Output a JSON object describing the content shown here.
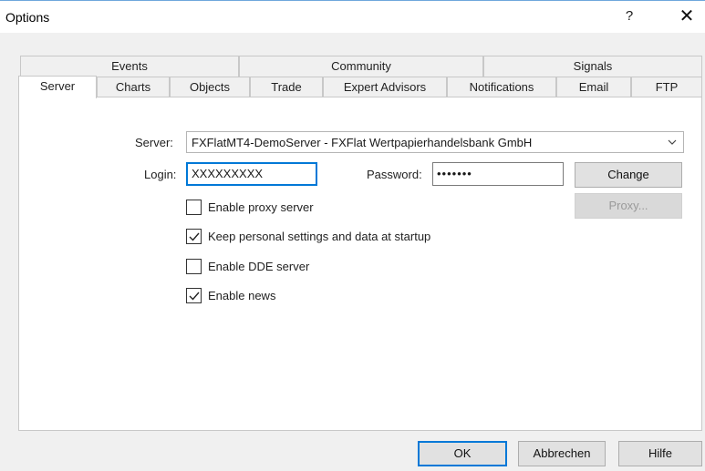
{
  "window": {
    "title": "Options",
    "help_glyph": "?",
    "close_glyph": "✕"
  },
  "tabs_top": [
    {
      "label": "Events"
    },
    {
      "label": "Community"
    },
    {
      "label": "Signals"
    }
  ],
  "tabs_bottom": [
    {
      "label": "Server",
      "active": true
    },
    {
      "label": "Charts"
    },
    {
      "label": "Objects"
    },
    {
      "label": "Trade"
    },
    {
      "label": "Expert Advisors"
    },
    {
      "label": "Notifications"
    },
    {
      "label": "Email"
    },
    {
      "label": "FTP"
    }
  ],
  "server": {
    "label": "Server:",
    "value": "FXFlatMT4-DemoServer - FXFlat Wertpapierhandelsbank GmbH",
    "dropdown_icon": "chevron-down-icon"
  },
  "login": {
    "label": "Login:",
    "value": "XXXXXXXXX"
  },
  "password": {
    "label": "Password:",
    "value": "•••••••"
  },
  "buttons": {
    "change": "Change",
    "proxy": "Proxy...",
    "ok": "OK",
    "cancel": "Abbrechen",
    "help": "Hilfe"
  },
  "checkboxes": [
    {
      "label": "Enable proxy server",
      "checked": false
    },
    {
      "label": "Keep personal settings and data at startup",
      "checked": true
    },
    {
      "label": "Enable DDE server",
      "checked": false
    },
    {
      "label": "Enable news",
      "checked": true
    }
  ],
  "colors": {
    "accent": "#0078d7",
    "dialog_bg": "#f0f0f0",
    "panel_bg": "#ffffff"
  }
}
